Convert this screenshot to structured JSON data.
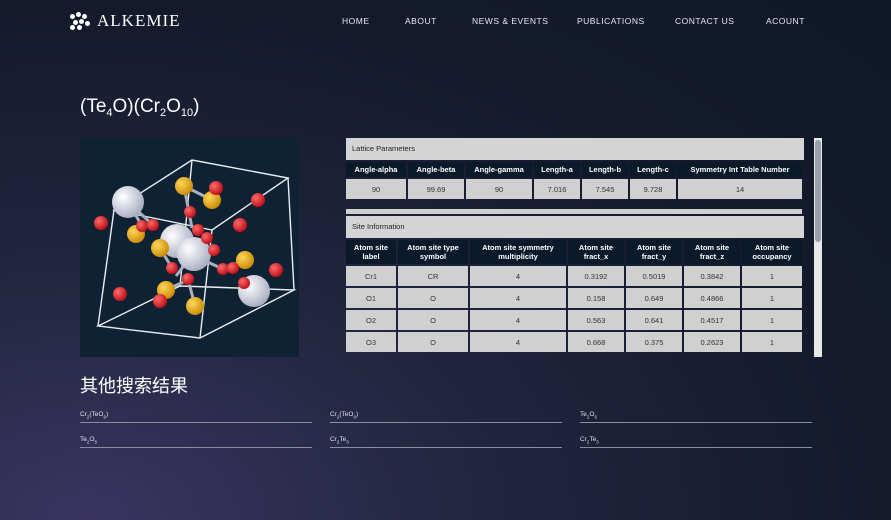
{
  "brand": {
    "name": "ALKEMIE",
    "logo_icon": "molecule-dots-icon"
  },
  "nav": [
    "HOME",
    "ABOUT",
    "NEWS & EVENTS",
    "PUBLICATIONS",
    "CONTACT US",
    "ACOUNT"
  ],
  "compound": {
    "title_parts": [
      "(Te",
      "4",
      "O)(Cr",
      "2",
      "O",
      "10",
      ")"
    ]
  },
  "lattice": {
    "section_label": "Lattice Parameters",
    "headers": [
      "Angle-alpha",
      "Angle-beta",
      "Angle-gamma",
      "Length-a",
      "Length-b",
      "Length-c",
      "Symmetry Int Table Number"
    ],
    "values": [
      "90",
      "99.69",
      "90",
      "7.016",
      "7.545",
      "9.728",
      "14"
    ]
  },
  "site": {
    "section_label": "Site Information",
    "headers": [
      "Atom site label",
      "Atom site type symbol",
      "Atom site symmetry multiplicity",
      "Atom site fract_x",
      "Atom site fract_y",
      "Atom site fract_z",
      "Atom site occupancy"
    ],
    "rows": [
      [
        "Cr1",
        "CR",
        "4",
        "0.3192",
        "0.5019",
        "0.3842",
        "1"
      ],
      [
        "O1",
        "O",
        "4",
        "0.158",
        "0.649",
        "0.4866",
        "1"
      ],
      [
        "O2",
        "O",
        "4",
        "0.563",
        "0.641",
        "0.4517",
        "1"
      ],
      [
        "O3",
        "O",
        "4",
        "0.668",
        "0.375",
        "0.2623",
        "1"
      ]
    ]
  },
  "other_results": {
    "title": "其他搜索结果",
    "links": [
      [
        "Cr",
        "2",
        "(TeO",
        "6",
        ")"
      ],
      [
        "Cr",
        "2",
        "(TeO",
        "6",
        ")"
      ],
      [
        "Te",
        "2",
        "O",
        "5",
        ""
      ],
      [
        "Te",
        "2",
        "O",
        "5",
        ""
      ],
      [
        "Cr",
        "2",
        "Te",
        "3",
        ""
      ],
      [
        "Cr",
        "2",
        "Te",
        "3",
        ""
      ]
    ]
  },
  "colors": {
    "oxygen": "#e3141f",
    "tellurium": "#c8ccdc",
    "chromium": "#e8a612"
  }
}
